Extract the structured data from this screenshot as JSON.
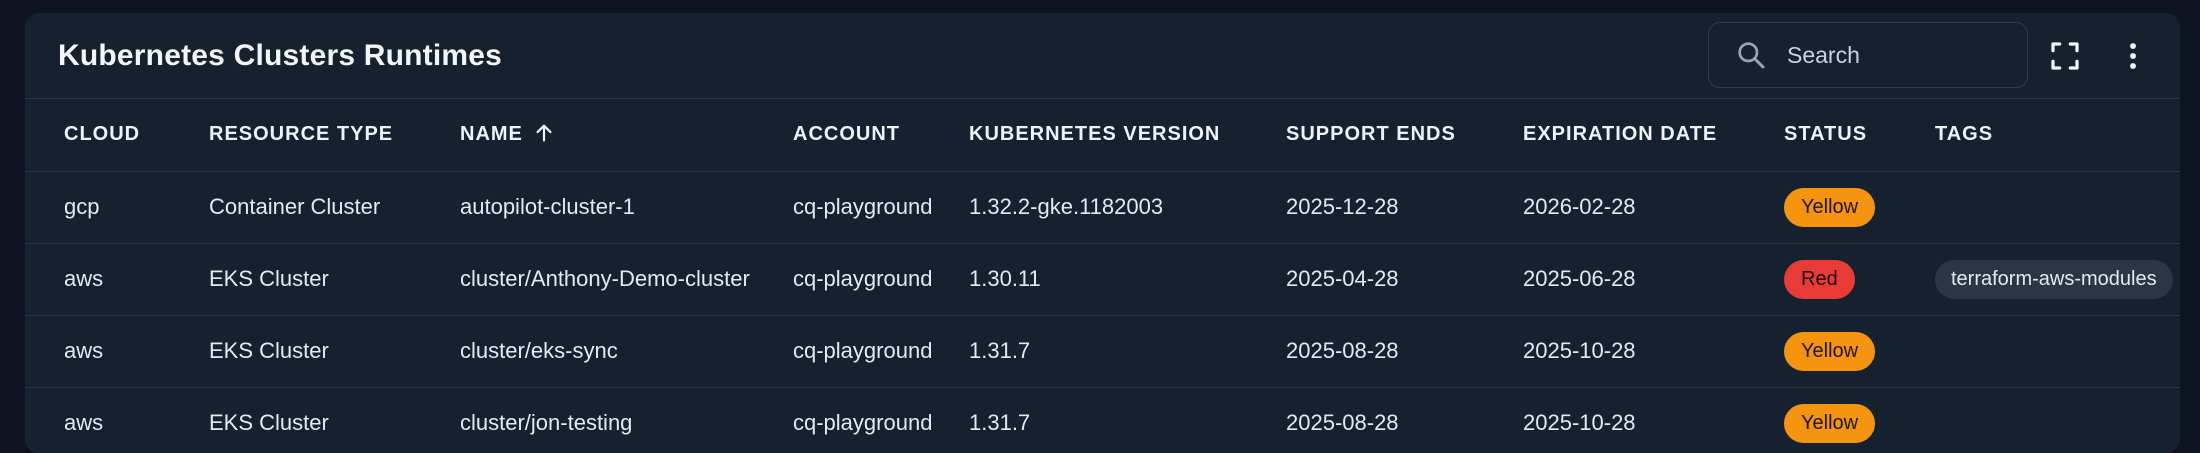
{
  "panel": {
    "title": "Kubernetes Clusters Runtimes"
  },
  "toolbar": {
    "search_placeholder": "Search",
    "search_icon": "search-icon",
    "fullscreen_icon": "fullscreen-icon",
    "more_icon": "more-vertical-icon"
  },
  "table": {
    "columns": [
      "CLOUD",
      "RESOURCE TYPE",
      "NAME",
      "ACCOUNT",
      "KUBERNETES VERSION",
      "SUPPORT ENDS",
      "EXPIRATION DATE",
      "STATUS",
      "TAGS"
    ],
    "sort": {
      "column": "NAME",
      "direction": "ascending",
      "icon": "arrow-up-icon"
    },
    "rows": [
      {
        "cloud": "gcp",
        "resource_type": "Container Cluster",
        "name": "autopilot-cluster-1",
        "account": "cq-playground",
        "version": "1.32.2-gke.1182003",
        "support_ends": "2025-12-28",
        "expiration_date": "2026-02-28",
        "status": "Yellow",
        "tags": ""
      },
      {
        "cloud": "aws",
        "resource_type": "EKS Cluster",
        "name": "cluster/Anthony-Demo-cluster",
        "account": "cq-playground",
        "version": "1.30.11",
        "support_ends": "2025-04-28",
        "expiration_date": "2025-06-28",
        "status": "Red",
        "tags": "terraform-aws-modules"
      },
      {
        "cloud": "aws",
        "resource_type": "EKS Cluster",
        "name": "cluster/eks-sync",
        "account": "cq-playground",
        "version": "1.31.7",
        "support_ends": "2025-08-28",
        "expiration_date": "2025-10-28",
        "status": "Yellow",
        "tags": ""
      },
      {
        "cloud": "aws",
        "resource_type": "EKS Cluster",
        "name": "cluster/jon-testing",
        "account": "cq-playground",
        "version": "1.31.7",
        "support_ends": "2025-08-28",
        "expiration_date": "2025-10-28",
        "status": "Yellow",
        "tags": ""
      }
    ]
  },
  "colors": {
    "page_background": "#0d1320",
    "panel_background": "#162130",
    "status_yellow": "#f5940f",
    "status_red": "#e83b36",
    "tag_background": "#2c3544"
  }
}
